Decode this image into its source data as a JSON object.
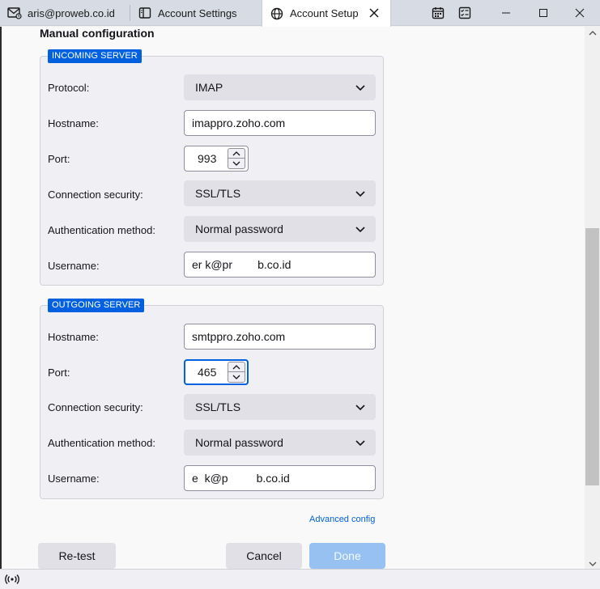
{
  "tabs": [
    {
      "label": "aris@proweb.co.id",
      "icon": "mail-icon",
      "active": false
    },
    {
      "label": "Account Settings",
      "icon": "settings-panel-icon",
      "active": false
    },
    {
      "label": "Account Setup",
      "icon": "globe-icon",
      "active": true
    }
  ],
  "window_controls": [
    "calendar-icon",
    "tasks-icon",
    "minimize-icon",
    "maximize-icon",
    "close-icon"
  ],
  "heading": "Manual configuration",
  "incoming": {
    "legend": "INCOMING SERVER",
    "protocol_label": "Protocol:",
    "protocol_value": "IMAP",
    "hostname_label": "Hostname:",
    "hostname_value": "imappro.zoho.com",
    "port_label": "Port:",
    "port_value": "993",
    "security_label": "Connection security:",
    "security_value": "SSL/TLS",
    "auth_label": "Authentication method:",
    "auth_value": "Normal password",
    "username_label": "Username:",
    "username_value": "er k@pr        b.co.id"
  },
  "outgoing": {
    "legend": "OUTGOING SERVER",
    "hostname_label": "Hostname:",
    "hostname_value": "smtppro.zoho.com",
    "port_label": "Port:",
    "port_value": "465",
    "security_label": "Connection security:",
    "security_value": "SSL/TLS",
    "auth_label": "Authentication method:",
    "auth_value": "Normal password",
    "username_label": "Username:",
    "username_value": "e  k@p         b.co.id"
  },
  "advanced_link": "Advanced config",
  "buttons": {
    "retest": "Re-test",
    "cancel": "Cancel",
    "done": "Done"
  },
  "colors": {
    "accent": "#0060df",
    "done_disabled": "#96c1f0"
  }
}
